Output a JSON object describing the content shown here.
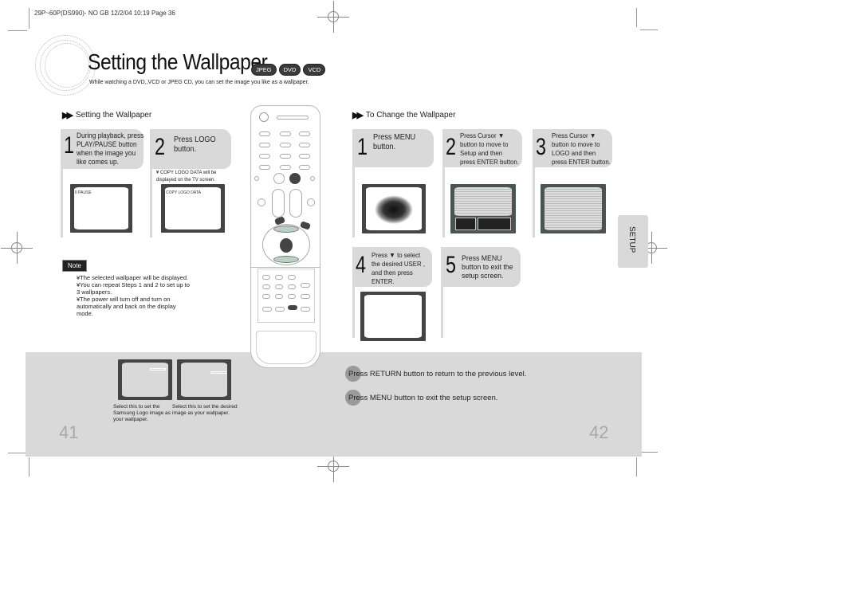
{
  "print_header": "29P~60P(DS990)- NO GB  12/2/04 10:19  Page 36",
  "title": "Setting the Wallpaper",
  "badges": [
    "JPEG",
    "DVD",
    "VCD"
  ],
  "subtitle": "While watching a DVD,,VCD or JPEG CD, you can set the image you like as a wallpaper.",
  "left_section": {
    "heading": "Setting the Wallpaper",
    "steps": [
      {
        "num": "1",
        "lines": [
          "During playback, press",
          "PLAY/PAUSE  button",
          "when the image you",
          "like comes up."
        ],
        "screen_text": "II PAUSE"
      },
      {
        "num": "2",
        "lines": [
          "Press LOGO",
          "button."
        ],
        "note_lines": [
          "¥ COPY LOGO DATA      will be",
          "   displayed on the TV screen."
        ],
        "screen_text": "COPY LOGO DATA"
      }
    ],
    "note_label": "Note",
    "notes": [
      "¥The selected wallpaper will be displayed.",
      "¥You can repeat Steps 1 and 2 to set up to",
      "  3 wallpapers.",
      "¥The power will turn off and turn on",
      "  automatically and back on the display",
      "  mode."
    ]
  },
  "right_section": {
    "heading": "To Change the Wallpaper",
    "steps": [
      {
        "num": "1",
        "lines": [
          "Press MENU",
          "button."
        ]
      },
      {
        "num": "2",
        "lines": [
          "Press Cursor ▼",
          "button to move to",
          " Setup  and then",
          "press ENTER button."
        ]
      },
      {
        "num": "3",
        "lines": [
          "Press Cursor ▼",
          "button to move to",
          " LOGO  and then",
          "press ENTER button."
        ]
      },
      {
        "num": "4",
        "lines": [
          "Press ▼  to select",
          "the desired  USER ,",
          "and then press",
          "ENTER."
        ]
      },
      {
        "num": "5",
        "lines": [
          "Press MENU",
          "button to exit the",
          "setup screen."
        ]
      }
    ]
  },
  "bottom": {
    "captions": [
      [
        "Select this to set the",
        "Samsung Logo image as",
        "your wallpaper."
      ],
      [
        "Select this to set the desired",
        "image as your wallpaper."
      ]
    ],
    "tips": [
      "Press RETURN button to return to the previous level.",
      "Press MENU button to exit the setup screen."
    ],
    "page_left": "41",
    "page_right": "42"
  },
  "side_tab": "SETUP",
  "remote_icons": [
    "power-icon",
    "stop-icon",
    "play-pause-icon",
    "volume-plus-icon",
    "volume-minus-icon",
    "tuning-up-icon",
    "tuning-down-icon",
    "cursor-up-icon",
    "enter-icon",
    "cursor-down-icon",
    "logo-button"
  ]
}
